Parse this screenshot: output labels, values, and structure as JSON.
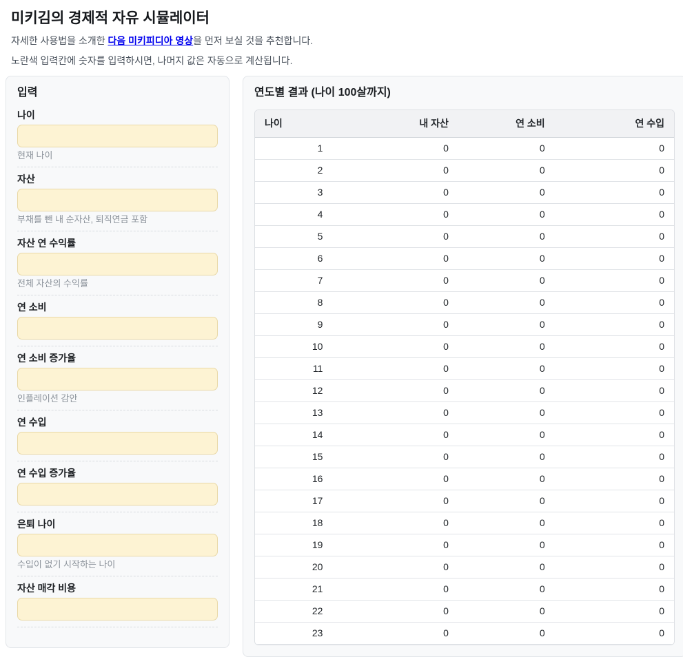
{
  "colors": {
    "link_blue": "#0000ee",
    "input_bg": "#fdf3d3",
    "input_border": "#e9d8a6",
    "panel_bg": "#f8f9fa",
    "table_header_bg": "#f1f2f4"
  },
  "page": {
    "title": "미키김의 경제적 자유 시뮬레이터",
    "intro_prefix": "자세한 사용법을 소개한 ",
    "intro_link": "다음 미키피디아 영상",
    "intro_suffix": "을 먼저 보실 것을 추천합니다.",
    "intro_line2": "노란색 입력칸에 숫자를 입력하시면, 나머지 값은 자동으로 계산됩니다."
  },
  "input_panel": {
    "header": "입력",
    "fields": [
      {
        "name": "age",
        "label": "나이",
        "value": "",
        "helper": "현재 나이"
      },
      {
        "name": "assets",
        "label": "자산",
        "value": "",
        "helper": "부채를 뺀 내 순자산, 퇴직연금 포함"
      },
      {
        "name": "asset-annual-return",
        "label": "자산 연 수익률",
        "value": "",
        "helper": "전체 자산의 수익률"
      },
      {
        "name": "annual-spending",
        "label": "연 소비",
        "value": "",
        "helper": ""
      },
      {
        "name": "annual-spending-growth",
        "label": "연 소비 증가율",
        "value": "",
        "helper": "인플레이션 감안"
      },
      {
        "name": "annual-income",
        "label": "연 수입",
        "value": "",
        "helper": ""
      },
      {
        "name": "annual-income-growth",
        "label": "연 수입 증가율",
        "value": "",
        "helper": ""
      },
      {
        "name": "retirement-age",
        "label": "은퇴 나이",
        "value": "",
        "helper": "수입이 없기 시작하는 나이"
      },
      {
        "name": "asset-sale-cost",
        "label": "자산 매각 비용",
        "value": "",
        "helper": ""
      }
    ]
  },
  "results_panel": {
    "header": "연도별 결과 (나이 100살까지)",
    "table": {
      "columns": [
        "나이",
        "내 자산",
        "연 소비",
        "연 수입"
      ],
      "rows": [
        [
          1,
          0,
          0,
          0
        ],
        [
          2,
          0,
          0,
          0
        ],
        [
          3,
          0,
          0,
          0
        ],
        [
          4,
          0,
          0,
          0
        ],
        [
          5,
          0,
          0,
          0
        ],
        [
          6,
          0,
          0,
          0
        ],
        [
          7,
          0,
          0,
          0
        ],
        [
          8,
          0,
          0,
          0
        ],
        [
          9,
          0,
          0,
          0
        ],
        [
          10,
          0,
          0,
          0
        ],
        [
          11,
          0,
          0,
          0
        ],
        [
          12,
          0,
          0,
          0
        ],
        [
          13,
          0,
          0,
          0
        ],
        [
          14,
          0,
          0,
          0
        ],
        [
          15,
          0,
          0,
          0
        ],
        [
          16,
          0,
          0,
          0
        ],
        [
          17,
          0,
          0,
          0
        ],
        [
          18,
          0,
          0,
          0
        ],
        [
          19,
          0,
          0,
          0
        ],
        [
          20,
          0,
          0,
          0
        ],
        [
          21,
          0,
          0,
          0
        ],
        [
          22,
          0,
          0,
          0
        ],
        [
          23,
          0,
          0,
          0
        ]
      ]
    }
  }
}
